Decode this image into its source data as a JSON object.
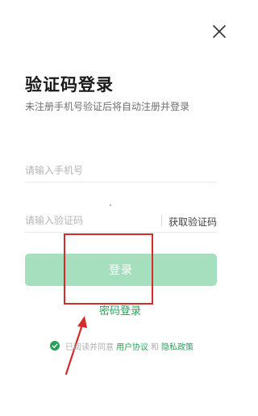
{
  "header": {
    "close_icon": "close-icon"
  },
  "title": "验证码登录",
  "subtitle": "未注册手机号验证后将自动注册并登录",
  "phone": {
    "placeholder": "请输入手机号",
    "value": ""
  },
  "code": {
    "placeholder": "请输入验证码",
    "value": "",
    "get_code_label": "获取验证码"
  },
  "login_button": {
    "label": "登录",
    "color": "#a5dfbd"
  },
  "password_login_label": "密码登录",
  "agreement": {
    "checked": true,
    "prefix": "已阅读并同意",
    "user_agreement": "用户协议",
    "and": "和",
    "privacy_policy": "隐私政策"
  },
  "colors": {
    "accent_green": "#2aa15a",
    "annotation_red": "#d42b2b"
  }
}
